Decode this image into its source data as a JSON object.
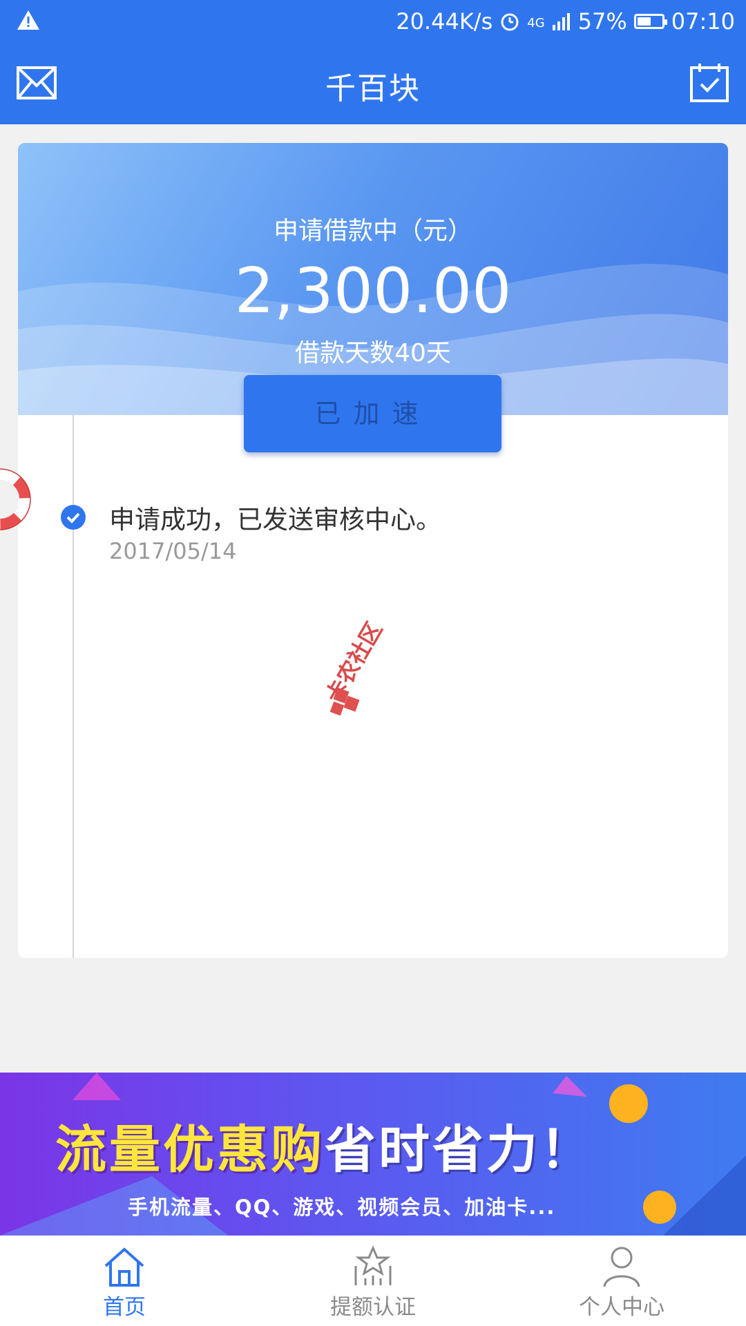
{
  "status_bar": {
    "speed": "20.44K/s",
    "network": "4G",
    "battery": "57%",
    "battery_level": 0.57,
    "time": "07:10"
  },
  "header": {
    "title": "千百块"
  },
  "loan": {
    "label": "申请借款中（元）",
    "amount": "2,300.00",
    "days": "借款天数40天",
    "button_label": "已加速"
  },
  "timeline": [
    {
      "text": "申请成功，已发送审核中心。",
      "date": "2017/05/14"
    }
  ],
  "watermark": {
    "text": "卡农社区"
  },
  "banner": {
    "headline_part1": "流量优惠购",
    "headline_part2": "省时省力！",
    "subtitle": "手机流量、QQ、游戏、视频会员、加油卡..."
  },
  "tabs": [
    {
      "label": "首页",
      "icon": "home-icon",
      "active": true
    },
    {
      "label": "提额认证",
      "icon": "star-certificate-icon",
      "active": false
    },
    {
      "label": "个人中心",
      "icon": "person-icon",
      "active": false
    }
  ],
  "colors": {
    "primary": "#2f76ee",
    "background": "#f1f1f1",
    "text_dark": "#333333",
    "text_muted": "#999999"
  }
}
